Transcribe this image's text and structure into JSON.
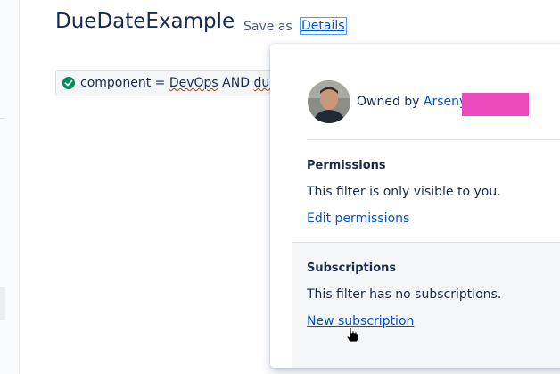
{
  "page": {
    "title": "DueDateExample",
    "save_as_label": "Save as",
    "details_label": "Details"
  },
  "jql": {
    "prefix": "component = ",
    "project": "DevOps",
    "middle": " AND ",
    "field": "dueda",
    "status_icon": "check-circle-icon",
    "status_color": "#00875a"
  },
  "details_popup": {
    "owner_prefix": "Owned by ",
    "owner_name": "Arseny",
    "redaction_color": "#eb4bbd",
    "permissions": {
      "title": "Permissions",
      "text": "This filter is only visible to you.",
      "link": "Edit permissions"
    },
    "subscriptions": {
      "title": "Subscriptions",
      "text": "This filter has no subscriptions.",
      "link": "New subscription"
    }
  },
  "colors": {
    "link": "#0052cc",
    "text": "#172b4d",
    "focus_ring": "#4c9aff"
  }
}
